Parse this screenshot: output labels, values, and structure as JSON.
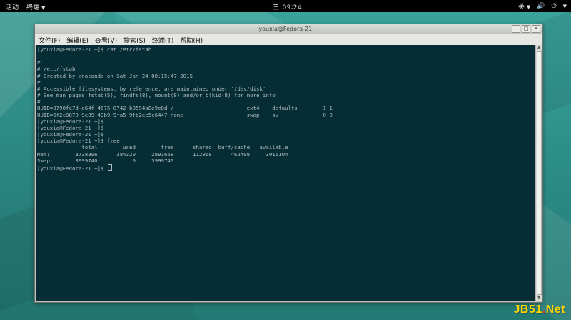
{
  "topbar": {
    "activities": "活动",
    "app_menu": "终端",
    "clock_prefix": "三",
    "clock_time": "09∶24",
    "input_method": "英"
  },
  "window": {
    "title": "youxia@Fedora-21:~",
    "menu": [
      "文件(F)",
      "编辑(E)",
      "查看(V)",
      "搜索(S)",
      "终端(T)",
      "帮助(H)"
    ]
  },
  "terminal": {
    "lines": [
      "[youxia@Fedora-21 ~]$ cat /etc/fstab",
      "",
      "#",
      "# /etc/fstab",
      "# Created by anaconda on Sat Jan 24 00:15:47 2015",
      "#",
      "# Accessible filesystems, by reference, are maintained under '/dev/disk'",
      "# See man pages fstab(5), findfs(8), mount(8) and/or blkid(8) for more info",
      "#",
      "UUID=8790fc7d-a64f-4675-8742-b0594a8e9c8d /                       ext4    defaults        1 1",
      "UUID=6f2c0870-9e89-49b9-9fa5-9fb2ec5c6447 none                    swap    sw              0 0",
      "[youxia@Fedora-21 ~]$",
      "[youxia@Fedora-21 ~]$",
      "[youxia@Fedora-21 ~]$",
      "[youxia@Fedora-21 ~]$ free",
      "              total        used        free      shared  buff/cache   available",
      "Mem:        3738396      384320     2891668      112968      462408     3016104",
      "Swap:       3999740           0     3999740"
    ],
    "prompt": "[youxia@Fedora-21 ~]$ "
  },
  "watermark": {
    "left": "JB51",
    "dot": ".",
    "right": "Net"
  }
}
